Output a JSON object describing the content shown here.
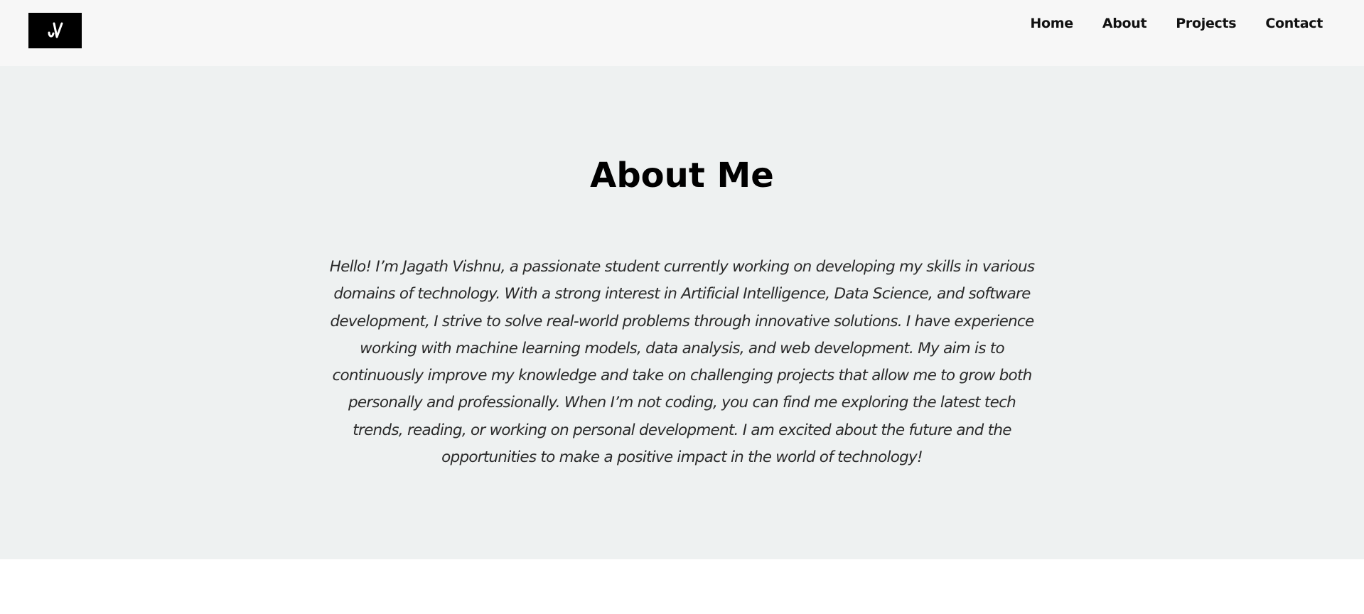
{
  "header": {
    "logo_text": "JV",
    "nav": [
      {
        "label": "Home"
      },
      {
        "label": "About"
      },
      {
        "label": "Projects"
      },
      {
        "label": "Contact"
      }
    ]
  },
  "about": {
    "title": "About Me",
    "body": "Hello! I’m Jagath Vishnu, a passionate student currently working on developing my skills in various domains of technology. With a strong interest in Artificial Intelligence, Data Science, and software development, I strive to solve real-world problems through innovative solutions. I have experience working with machine learning models, data analysis, and web development. My aim is to continuously improve my knowledge and take on challenging projects that allow me to grow both personally and professionally. When I’m not coding, you can find me exploring the latest tech trends, reading, or working on personal development. I am excited about the future and the opportunities to make a positive impact in the world of technology!"
  },
  "colors": {
    "navbar_bg": "#f7f7f7",
    "section_bg": "#eef1f1",
    "logo_bg": "#000000",
    "text": "#111111"
  }
}
